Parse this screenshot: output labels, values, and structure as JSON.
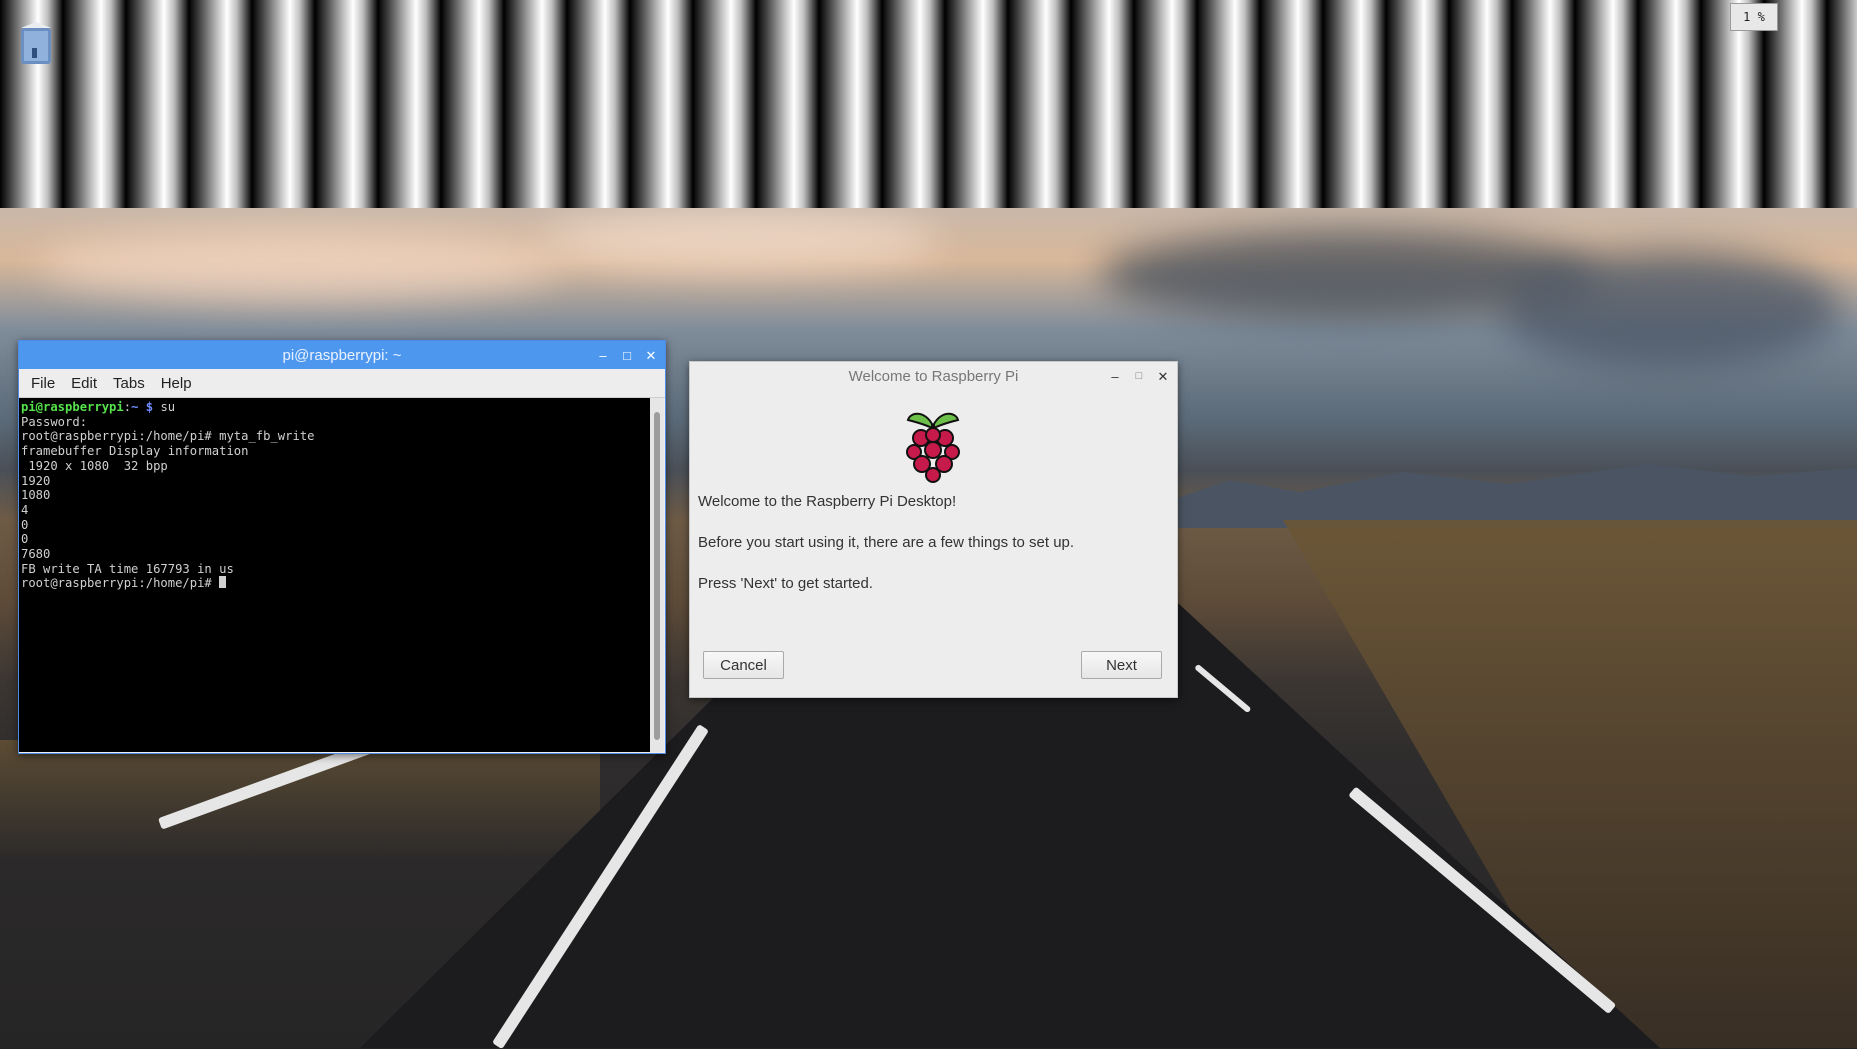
{
  "status": {
    "cpu_usage": "1 %"
  },
  "terminal": {
    "title": "pi@raspberrypi: ~",
    "menu": [
      "File",
      "Edit",
      "Tabs",
      "Help"
    ],
    "prompt_user": "pi@raspberrypi",
    "prompt_path": "~",
    "prompt_cmd": "su",
    "lines": [
      "Password:",
      "root@raspberrypi:/home/pi# myta_fb_write",
      "framebuffer Display information",
      " 1920 x 1080  32 bpp",
      "1920",
      "1080",
      "4",
      "0",
      "0",
      "7680",
      "FB write TA time 167793 in us"
    ],
    "last_prompt": "root@raspberrypi:/home/pi# "
  },
  "dialog": {
    "title": "Welcome to Raspberry Pi",
    "line1": "Welcome to the Raspberry Pi Desktop!",
    "line2": "Before you start using it, there are a few things to set up.",
    "line3": "Press 'Next' to get started.",
    "cancel_label": "Cancel",
    "next_label": "Next"
  },
  "icons": {
    "desktop": "trash-icon",
    "logo": "raspberry-pi-logo-icon",
    "minimize": "minimize-icon",
    "maximize": "maximize-icon",
    "close": "close-icon"
  },
  "colors": {
    "terminal_titlebar": "#4d98ee",
    "prompt_user": "#55e24a",
    "prompt_path": "#6f8cff"
  }
}
